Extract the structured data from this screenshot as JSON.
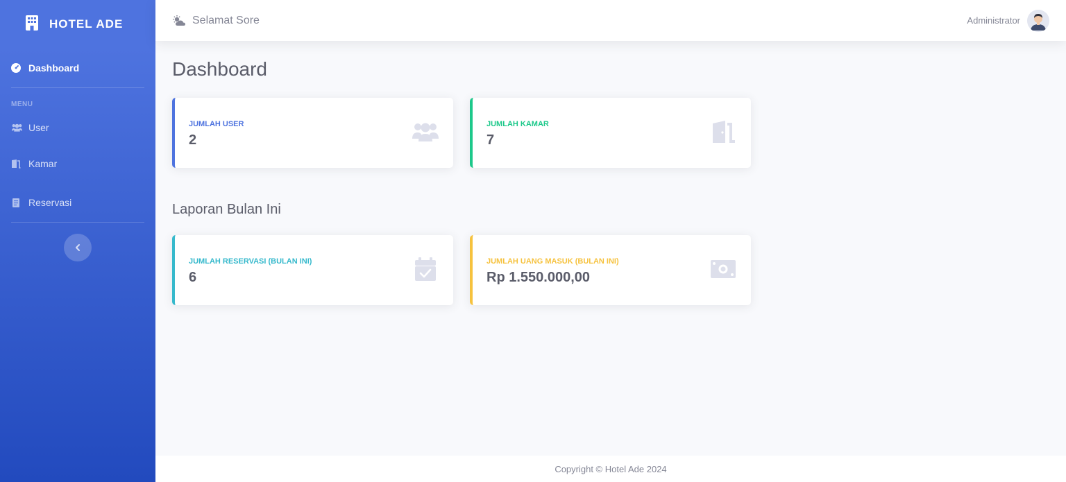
{
  "brand": {
    "name": "HOTEL ADE",
    "icon": "building-icon"
  },
  "sidebar": {
    "dashboard_label": "Dashboard",
    "heading": "MENU",
    "items": [
      {
        "label": "User",
        "icon": "users-icon"
      },
      {
        "label": "Kamar",
        "icon": "door-icon"
      },
      {
        "label": "Reservasi",
        "icon": "clipboard-icon"
      }
    ],
    "toggle_icon": "chevron-left-icon"
  },
  "topbar": {
    "greeting": "Selamat Sore",
    "greeting_icon": "cloud-sun-icon",
    "user_name": "Administrator"
  },
  "main": {
    "page_title": "Dashboard",
    "section_title": "Laporan Bulan Ini",
    "cards": [
      {
        "label": "JUMLAH USER",
        "value": "2",
        "icon": "users-icon",
        "color": "#4e73df"
      },
      {
        "label": "JUMLAH KAMAR",
        "value": "7",
        "icon": "door-open-icon",
        "color": "#1cc88a"
      },
      {
        "label": "JUMLAH RESERVASI (BULAN INI)",
        "value": "6",
        "icon": "calendar-check-icon",
        "color": "#36b9cc"
      },
      {
        "label": "JUMLAH UANG MASUK (BULAN INI)",
        "value": "Rp 1.550.000,00",
        "icon": "money-bill-icon",
        "color": "#f6c23e"
      }
    ]
  },
  "footer": {
    "text": "Copyright © Hotel Ade 2024"
  },
  "colors": {
    "primary": "#4e73df",
    "success": "#1cc88a",
    "info": "#36b9cc",
    "warning": "#f6c23e",
    "icon_muted": "#dddfeb"
  }
}
